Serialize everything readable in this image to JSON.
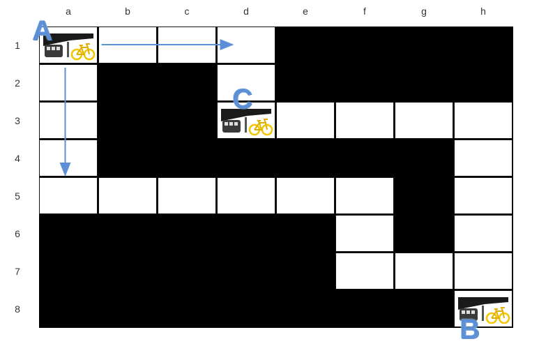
{
  "columns": [
    "a",
    "b",
    "c",
    "d",
    "e",
    "f",
    "g",
    "h"
  ],
  "rows": [
    "1",
    "2",
    "3",
    "4",
    "5",
    "6",
    "7",
    "8"
  ],
  "open_cells": [
    "a1",
    "b1",
    "c1",
    "d1",
    "a2",
    "d2",
    "a3",
    "d3",
    "e3",
    "f3",
    "g3",
    "h3",
    "a4",
    "h4",
    "a5",
    "b5",
    "c5",
    "d5",
    "e5",
    "f5",
    "h5",
    "f6",
    "h6",
    "f7",
    "g7",
    "h7",
    "h8"
  ],
  "markers": [
    {
      "label": "A",
      "cell": "a1",
      "icon": "train-bicycle-icon"
    },
    {
      "label": "B",
      "cell": "h8",
      "icon": "train-bicycle-icon"
    },
    {
      "label": "C",
      "cell": "d3",
      "icon": "train-bicycle-icon"
    }
  ],
  "arrows": [
    {
      "from": "b1",
      "to": "d1",
      "direction": "right"
    },
    {
      "from": "a2",
      "to": "a4",
      "direction": "down"
    }
  ],
  "colors": {
    "blocked": "#000000",
    "open": "#ffffff",
    "arrow": "#5b8fd6",
    "marker_letter": "#5b8fd6",
    "bicycle": "#f2c500"
  }
}
